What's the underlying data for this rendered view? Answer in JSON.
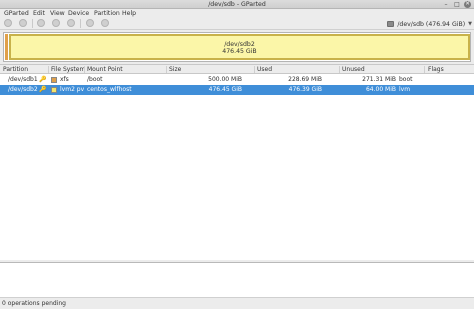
{
  "window": {
    "title": "/dev/sdb - GParted",
    "minimize_glyph": "–",
    "maximize_glyph": "□",
    "close_glyph": "✕"
  },
  "menu": {
    "items": [
      "GParted",
      "Edit",
      "View",
      "Device",
      "Partition",
      "Help"
    ]
  },
  "toolbar": {
    "buttons": [
      "new-icon",
      "delete-icon",
      "resize-icon",
      "copy-icon",
      "paste-icon",
      "undo-icon",
      "apply-icon"
    ],
    "device_selector": {
      "label": "/dev/sdb  (476.94 GiB)",
      "arrow": "▼",
      "icon": "disk-icon"
    }
  },
  "disk_map": {
    "partition_name": "/dev/sdb2",
    "partition_size": "476.45 GiB",
    "colors": {
      "boot_segment": "#e0a04a",
      "lvm_fill": "#fbf6a8",
      "lvm_border": "#c8b24a"
    }
  },
  "table": {
    "columns": [
      "Partition",
      "File System",
      "Mount Point",
      "Size",
      "Used",
      "Unused",
      "Flags"
    ],
    "rows": [
      {
        "partition": "/dev/sdb1",
        "key_icon": "🔑",
        "fs_color": "#e0a04a",
        "filesystem": "xfs",
        "mount_point": "/boot",
        "size": "500.00 MiB",
        "used": "228.69 MiB",
        "unused": "271.31 MiB",
        "flags": "boot",
        "selected": false
      },
      {
        "partition": "/dev/sdb2",
        "key_icon": "🔑",
        "fs_color": "#f4e56a",
        "filesystem": "lvm2 pv",
        "mount_point": "centos_wlfhost",
        "size": "476.45 GiB",
        "used": "476.39 GiB",
        "unused": "64.00 MiB",
        "flags": "lvm",
        "selected": true
      }
    ]
  },
  "status": {
    "text": "0 operations pending"
  },
  "colors": {
    "selection": "#3f8ed8"
  }
}
